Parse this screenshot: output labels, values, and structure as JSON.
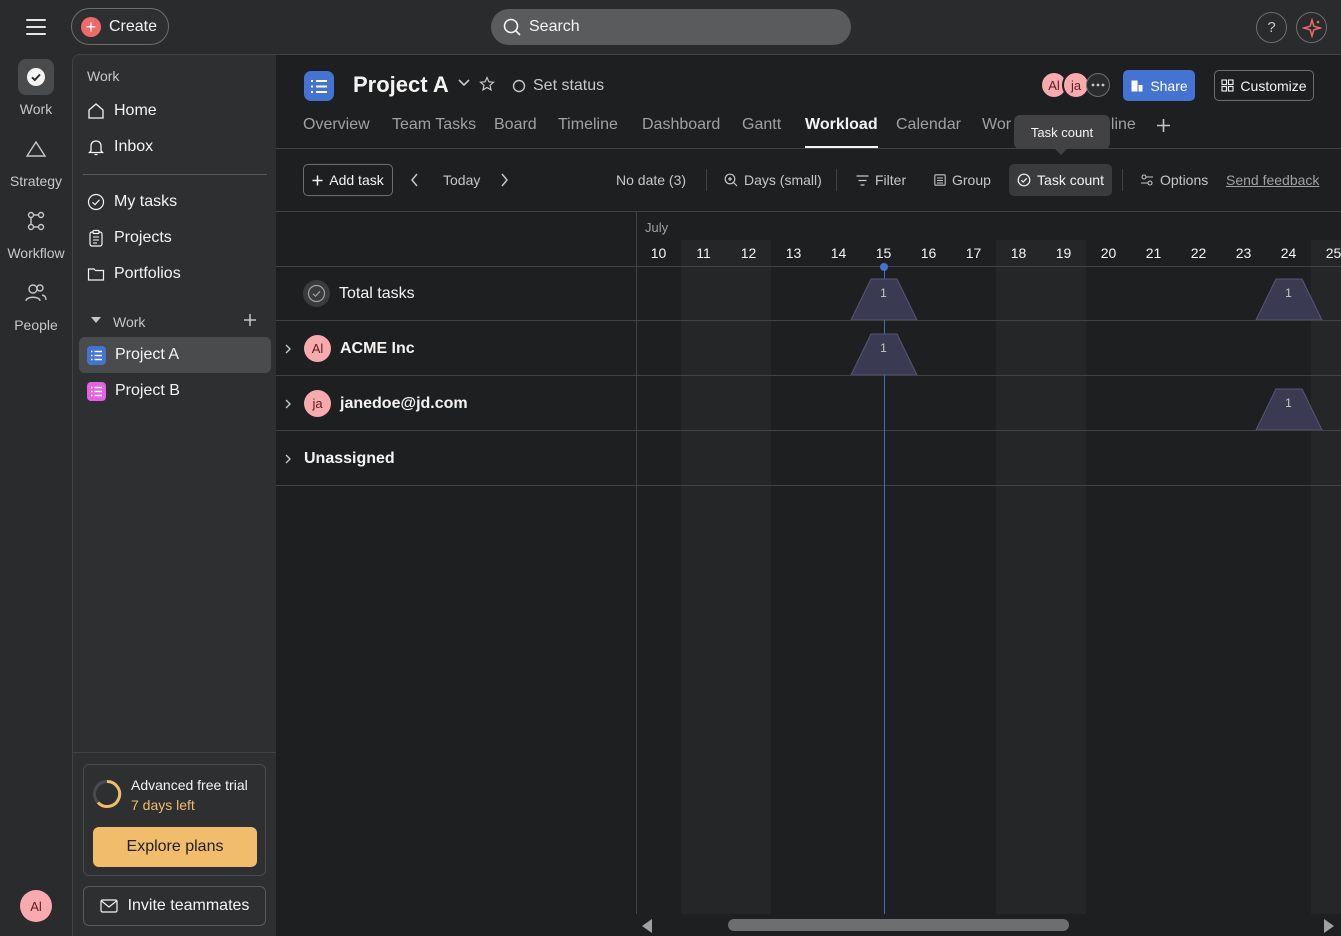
{
  "topbar": {
    "create_label": "Create",
    "search_placeholder": "Search",
    "help_label": "?"
  },
  "rail": {
    "items": [
      {
        "label": "Work"
      },
      {
        "label": "Strategy"
      },
      {
        "label": "Workflow"
      },
      {
        "label": "People"
      }
    ],
    "user_initials": "Al"
  },
  "sidebar": {
    "section_work": "Work",
    "nav": [
      {
        "label": "Home"
      },
      {
        "label": "Inbox"
      },
      {
        "label": "My tasks"
      },
      {
        "label": "Projects"
      },
      {
        "label": "Portfolios"
      }
    ],
    "team_header": "Work",
    "projects": [
      {
        "label": "Project A",
        "color": "#4573d2"
      },
      {
        "label": "Project B",
        "color": "#e362e3"
      }
    ],
    "trial_title": "Advanced free trial",
    "trial_days": "7 days left",
    "explore_label": "Explore plans",
    "invite_label": "Invite teammates"
  },
  "project": {
    "title": "Project A",
    "set_status": "Set status",
    "members": [
      "Al",
      "ja"
    ],
    "share_label": "Share",
    "customize_label": "Customize",
    "tabs": [
      {
        "label": "Overview"
      },
      {
        "label": "Team Tasks"
      },
      {
        "label": "Board"
      },
      {
        "label": "Timeline"
      },
      {
        "label": "Dashboard"
      },
      {
        "label": "Gantt"
      },
      {
        "label": "Workload"
      },
      {
        "label": "Calendar"
      },
      {
        "label": "Wor"
      },
      {
        "label": "eline"
      }
    ],
    "active_tab": "Workload",
    "tooltip": "Task count"
  },
  "toolbar": {
    "add_task": "Add task",
    "today": "Today",
    "no_date": "No date (3)",
    "days": "Days (small)",
    "filter": "Filter",
    "group": "Group",
    "task_count": "Task count",
    "options": "Options",
    "feedback": "Send feedback"
  },
  "workload": {
    "month": "July",
    "days": [
      "10",
      "11",
      "12",
      "13",
      "14",
      "15",
      "16",
      "17",
      "18",
      "19",
      "20",
      "21",
      "22",
      "23",
      "24",
      "25"
    ],
    "weekend_days": [
      "11",
      "12",
      "18",
      "19",
      "25"
    ],
    "today": "15",
    "rows": [
      {
        "label": "Total tasks",
        "initials": "",
        "bars": [
          {
            "day": "15",
            "count": "1"
          },
          {
            "day": "24",
            "count": "1"
          }
        ]
      },
      {
        "label": "ACME Inc",
        "initials": "Al",
        "bars": [
          {
            "day": "15",
            "count": "1"
          }
        ]
      },
      {
        "label": "janedoe@jd.com",
        "initials": "ja",
        "bars": [
          {
            "day": "24",
            "count": "1"
          }
        ]
      },
      {
        "label": "Unassigned",
        "initials": "",
        "bars": []
      }
    ]
  }
}
